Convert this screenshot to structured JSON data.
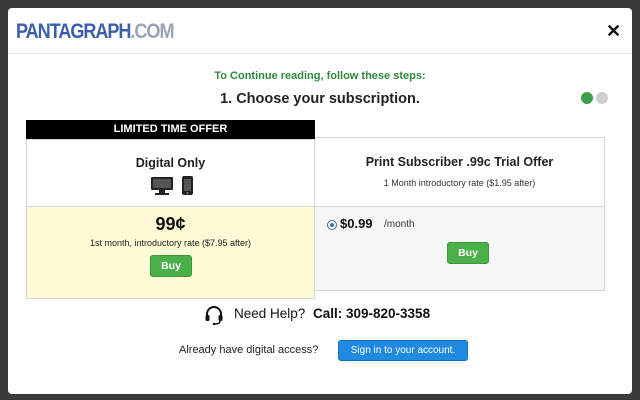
{
  "header": {
    "logo_main": "PANTAGRAPH",
    "logo_dot_com": ".COM",
    "close_glyph": "✕"
  },
  "steps": {
    "intro": "To Continue reading, follow these steps:",
    "title": "1. Choose your subscription.",
    "progress": {
      "current": 1,
      "total": 2
    }
  },
  "plans": {
    "digital": {
      "banner": "LIMITED TIME OFFER",
      "name": "Digital Only",
      "icons": [
        "desktop-icon",
        "phone-icon"
      ],
      "price": "99¢",
      "note": "1st month, introductory rate ($7.95 after)",
      "buy_label": "Buy",
      "background": "#fcfbd6"
    },
    "print": {
      "name": "Print Subscriber .99c Trial Offer",
      "subtitle": "1 Month introductory rate ($1.95 after)",
      "price": "$0.99",
      "per": "/month",
      "selected": true,
      "buy_label": "Buy",
      "background": "#f6f6f6"
    }
  },
  "help": {
    "label": "Need Help?",
    "call": "Call: 309-820-3358"
  },
  "signin": {
    "prompt": "Already have digital access?",
    "button_label": "Sign in to your account."
  },
  "colors": {
    "accent_green": "#4cb04a",
    "intro_green": "#2f8a3a",
    "brand_blue": "#3c5fa8",
    "signin_blue": "#1f8ae0"
  }
}
